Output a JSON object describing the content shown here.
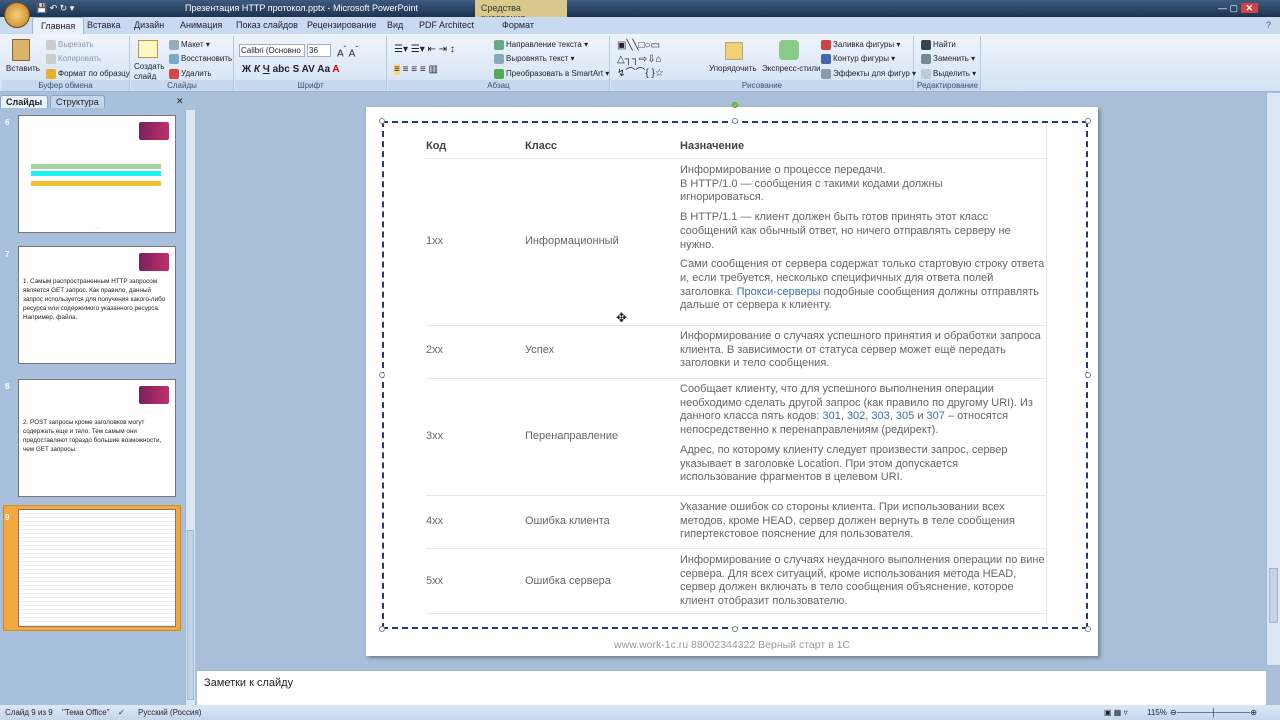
{
  "window": {
    "title": "Презентация HTTP протокол.pptx - Microsoft PowerPoint",
    "context_tab": "Средства рисования"
  },
  "tabs": [
    "Главная",
    "Вставка",
    "Дизайн",
    "Анимация",
    "Показ слайдов",
    "Рецензирование",
    "Вид",
    "PDF Architect",
    "Формат"
  ],
  "ribbon": {
    "clipboard": {
      "paste": "Вставить",
      "cut": "Вырезать",
      "copy": "Копировать",
      "format": "Формат по образцу",
      "label": "Буфер обмена"
    },
    "slides": {
      "new": "Создать слайд",
      "layout": "Макет",
      "reset": "Восстановить",
      "delete": "Удалить",
      "label": "Слайды"
    },
    "font": {
      "name": "Calibri (Основно",
      "size": "36",
      "label": "Шрифт"
    },
    "paragraph": {
      "direction": "Направление текста",
      "align": "Выровнять текст",
      "smartart": "Преобразовать в SmartArt",
      "label": "Абзац"
    },
    "drawing": {
      "arrange": "Упорядочить",
      "styles": "Экспресс-стили",
      "fill": "Заливка фигуры",
      "outline": "Контур фигуры",
      "effects": "Эффекты для фигур",
      "label": "Рисование"
    },
    "editing": {
      "find": "Найти",
      "replace": "Заменить",
      "select": "Выделить",
      "label": "Редактирование"
    }
  },
  "panel": {
    "tabs": [
      "Слайды",
      "Структура"
    ],
    "thumbs": [
      {
        "num": "6",
        "text": ""
      },
      {
        "num": "7",
        "text": "1. Самым распространенным HTTP запросом является GET запрос. Как правило, данный запрос используется для получения какого-либо ресурса или содержимого указанного ресурса. Например, файла."
      },
      {
        "num": "8",
        "text": "2. POST запросы кроме заголовков могут содержать еще и тело. Тем самым они предоставляют гораздо большие возможности, чем GET запросы."
      },
      {
        "num": "9",
        "text": ""
      }
    ]
  },
  "slide": {
    "headers": [
      "Код",
      "Класс",
      "Назначение"
    ],
    "rows": [
      {
        "code": "1xx",
        "cls": "Информационный",
        "p": [
          "Информирование о процессе передачи.",
          "В HTTP/1.0 — сообщения с такими кодами должны игнорироваться.",
          "В HTTP/1.1 — клиент должен быть готов принять этот класс сообщений как обычный ответ, но ничего отправлять серверу не нужно.",
          "Сами сообщения от сервера содержат только стартовую строку ответа и, если требуется, несколько специфичных для ответа полей заголовка.",
          "Прокси-серверы",
          "подобные сообщения должны отправлять дальше от сервера к клиенту."
        ]
      },
      {
        "code": "2xx",
        "cls": "Успех",
        "p": [
          "Информирование о случаях успешного принятия и обработки запроса клиента. В зависимости от статуса сервер может ещё передать заголовки и тело сообщения."
        ]
      },
      {
        "code": "3xx",
        "cls": "Перенаправление",
        "p": [
          "Сообщает клиенту, что для успешного выполнения операции необходимо сделать другой запрос (как правило по другому URI). Из данного класса пять кодов:",
          "301",
          ", ",
          "302",
          ", ",
          "303",
          ", ",
          "305",
          " и ",
          "307",
          " – относятся непосредственно к перенаправлениям (редирект).",
          "Адрес, по которому клиенту следует произвести запрос, сервер указывает в заголовке Location. При этом допускается использование фрагментов в целевом URI."
        ]
      },
      {
        "code": "4xx",
        "cls": "Ошибка клиента",
        "p": [
          "Указание ошибок со стороны клиента. При использовании всех методов, кроме HEAD, сервер должен вернуть в теле сообщения гипертекстовое пояснение для пользователя."
        ]
      },
      {
        "code": "5xx",
        "cls": "Ошибка сервера",
        "p": [
          "Информирование о случаях неудачного выполнения операции по вине сервера. Для всех ситуаций, кроме использования метода HEAD, сервер должен включать в тело сообщения объяснение, которое клиент отобразит пользователю."
        ]
      }
    ],
    "footer": "www.work-1c.ru 88002344322   Верный старт в 1С"
  },
  "notes": "Заметки к слайду",
  "status": {
    "slide": "Слайд 9 из 9",
    "theme": "\"Тема Office\"",
    "lang": "Русский (Россия)",
    "zoom": "115%"
  }
}
